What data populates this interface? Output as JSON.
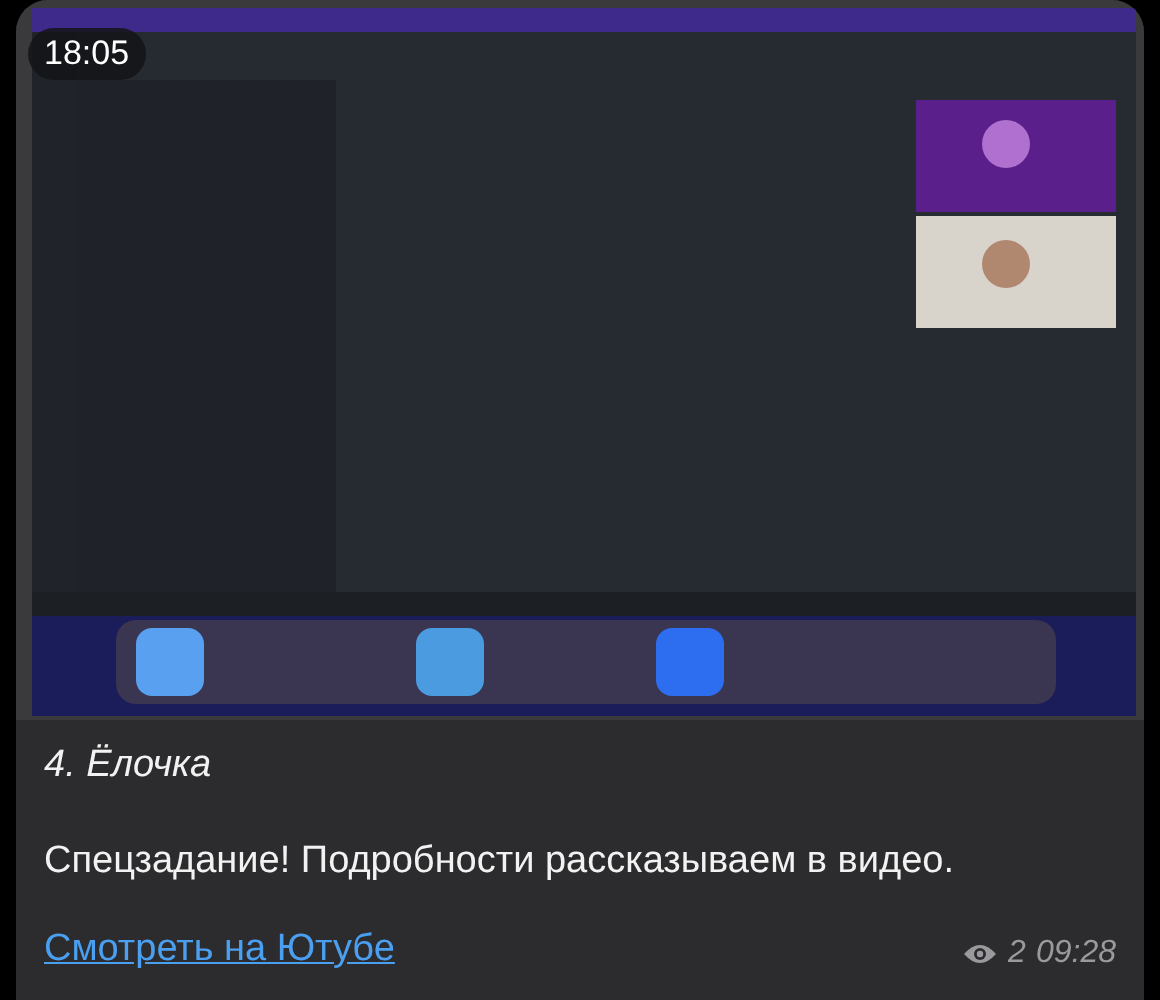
{
  "media": {
    "kind": "picture",
    "duration": "18:05"
  },
  "caption": {
    "title": "4. Ёлочка",
    "text": "Спецзадание! Подробности рассказываем в видео.",
    "link": "Смотреть на Ютубе"
  },
  "footer": {
    "views": "2",
    "time": "09:28"
  }
}
